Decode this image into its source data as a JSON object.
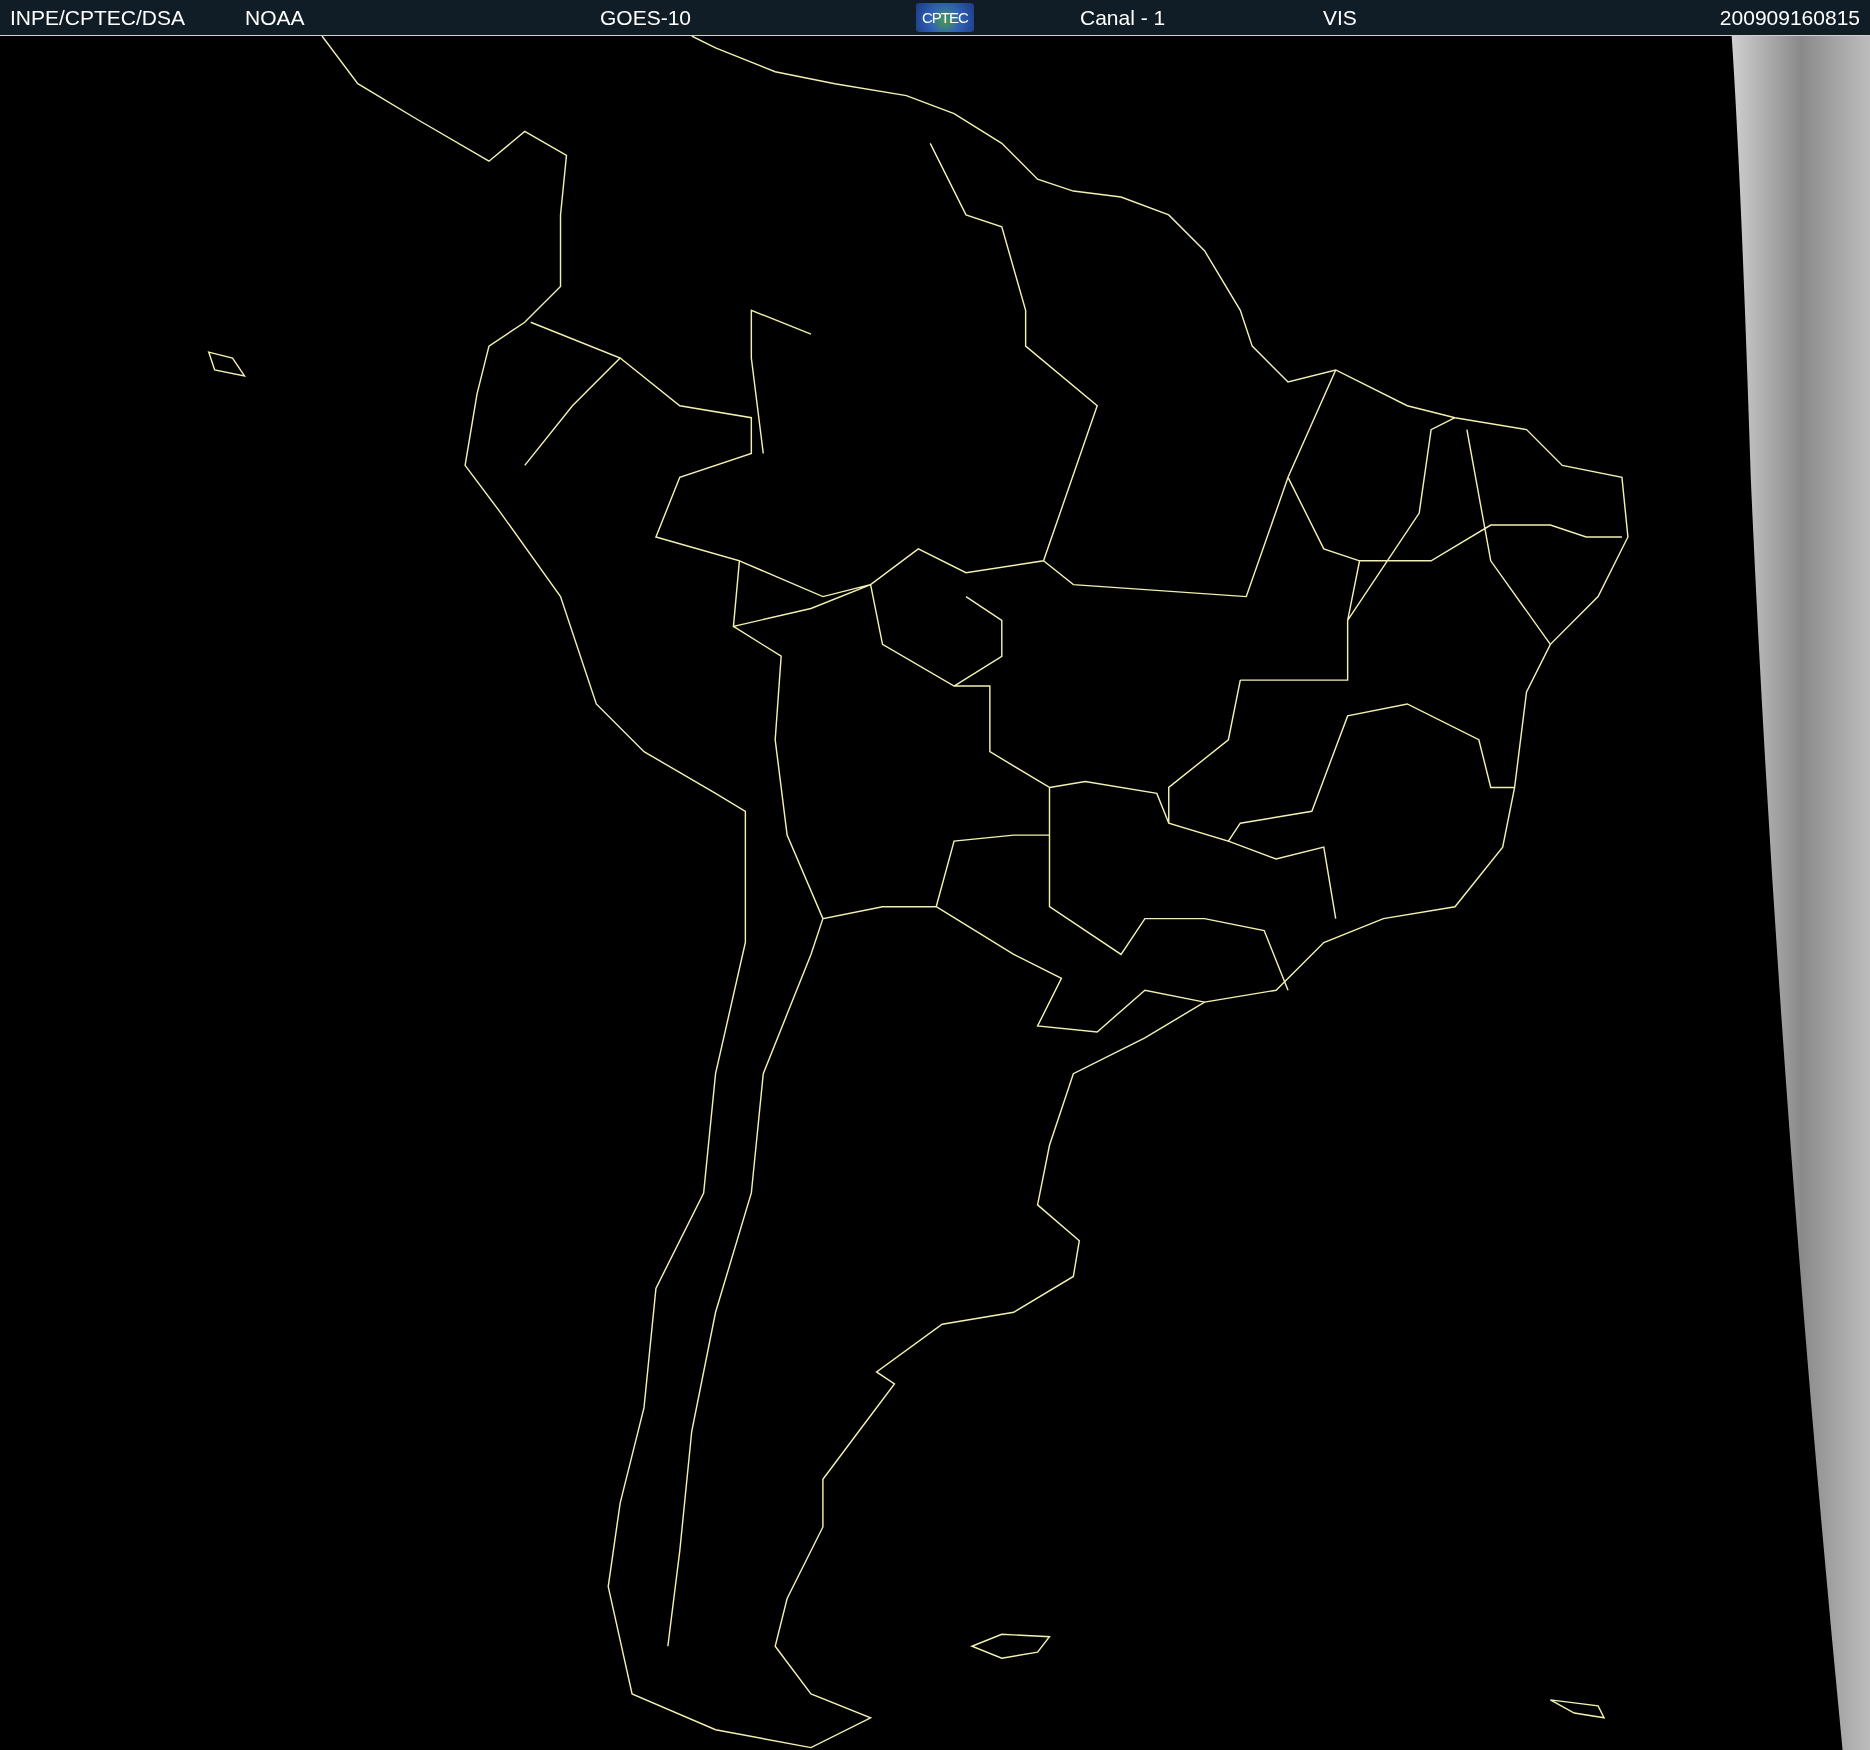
{
  "header": {
    "source": "INPE/CPTEC/DSA",
    "agency": "NOAA",
    "satellite": "GOES-10",
    "logo": "CPTEC",
    "channel": "Canal - 1",
    "band": "VIS",
    "timestamp": "200909160815"
  }
}
